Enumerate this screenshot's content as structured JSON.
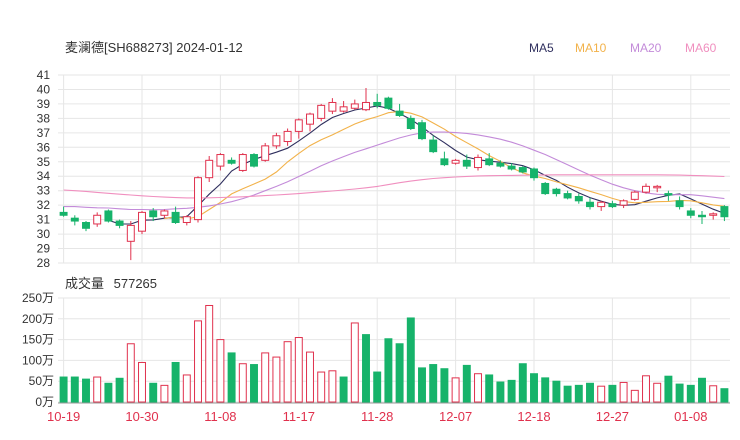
{
  "header": {
    "title": "麦澜德[SH688273] 2024-01-12",
    "legend": [
      {
        "label": "MA5",
        "color": "#2f2f5e"
      },
      {
        "label": "MA10",
        "color": "#f2b24a"
      },
      {
        "label": "MA20",
        "color": "#c38bd9"
      },
      {
        "label": "MA60",
        "color": "#f08fbf"
      }
    ]
  },
  "volume_header": {
    "label": "成交量",
    "value": "577265"
  },
  "colors": {
    "up": "#e0314d",
    "down": "#16b36a",
    "grid": "#e6e6e6",
    "axis": "#333333",
    "date_label": "#e0314d"
  },
  "chart_data": [
    {
      "type": "candlestick",
      "title": "麦澜德[SH688273] 2024-01-12",
      "ylim": [
        28,
        41
      ],
      "y_ticks": [
        "41",
        "40",
        "39",
        "38",
        "37",
        "36",
        "35",
        "34",
        "33",
        "32",
        "31",
        "30",
        "29",
        "28"
      ],
      "x_ticks": [
        {
          "label": "10-19",
          "index": 0
        },
        {
          "label": "10-30",
          "index": 7
        },
        {
          "label": "11-08",
          "index": 14
        },
        {
          "label": "11-17",
          "index": 21
        },
        {
          "label": "11-28",
          "index": 28
        },
        {
          "label": "12-07",
          "index": 35
        },
        {
          "label": "12-18",
          "index": 42
        },
        {
          "label": "12-27",
          "index": 49
        },
        {
          "label": "01-08",
          "index": 56
        }
      ],
      "grid": true,
      "ohlc": [
        [
          31.5,
          31.9,
          31.2,
          31.3
        ],
        [
          31.1,
          31.3,
          30.6,
          30.9
        ],
        [
          30.8,
          30.9,
          30.2,
          30.4
        ],
        [
          30.7,
          31.5,
          30.5,
          31.3
        ],
        [
          31.6,
          31.7,
          30.8,
          30.9
        ],
        [
          30.9,
          31.0,
          30.4,
          30.6
        ],
        [
          29.5,
          30.9,
          28.2,
          30.6
        ],
        [
          30.2,
          31.6,
          30.0,
          31.5
        ],
        [
          31.6,
          31.8,
          30.9,
          31.2
        ],
        [
          31.3,
          31.7,
          31.1,
          31.6
        ],
        [
          31.5,
          31.9,
          30.7,
          30.8
        ],
        [
          30.8,
          31.3,
          30.6,
          31.2
        ],
        [
          31.0,
          34.0,
          30.8,
          33.9
        ],
        [
          33.9,
          35.4,
          33.6,
          35.1
        ],
        [
          34.7,
          35.6,
          34.4,
          35.5
        ],
        [
          35.1,
          35.3,
          34.8,
          34.9
        ],
        [
          34.4,
          35.6,
          34.3,
          35.5
        ],
        [
          35.5,
          35.6,
          34.6,
          34.7
        ],
        [
          35.1,
          36.3,
          35.0,
          36.1
        ],
        [
          36.1,
          37.0,
          35.9,
          36.8
        ],
        [
          36.4,
          37.3,
          36.1,
          37.1
        ],
        [
          37.1,
          38.0,
          36.6,
          37.9
        ],
        [
          37.6,
          38.4,
          37.1,
          38.3
        ],
        [
          38.0,
          39.0,
          37.8,
          38.9
        ],
        [
          38.5,
          39.4,
          38.3,
          39.1
        ],
        [
          38.5,
          39.2,
          38.4,
          38.8
        ],
        [
          38.7,
          39.3,
          38.6,
          39.0
        ],
        [
          38.6,
          40.1,
          38.5,
          39.1
        ],
        [
          39.1,
          39.7,
          38.7,
          38.9
        ],
        [
          39.4,
          39.5,
          38.6,
          38.7
        ],
        [
          38.5,
          39.0,
          38.1,
          38.2
        ],
        [
          38.0,
          38.2,
          37.2,
          37.3
        ],
        [
          37.7,
          37.9,
          36.5,
          36.6
        ],
        [
          36.5,
          36.8,
          35.6,
          35.7
        ],
        [
          35.2,
          35.7,
          34.7,
          34.8
        ],
        [
          34.9,
          35.2,
          34.8,
          35.1
        ],
        [
          35.1,
          35.5,
          34.5,
          34.7
        ],
        [
          34.6,
          35.5,
          34.4,
          35.3
        ],
        [
          35.2,
          35.6,
          34.7,
          34.8
        ],
        [
          34.9,
          35.1,
          34.6,
          34.7
        ],
        [
          34.7,
          34.9,
          34.4,
          34.5
        ],
        [
          34.6,
          34.7,
          34.2,
          34.3
        ],
        [
          34.5,
          34.6,
          33.7,
          33.9
        ],
        [
          33.5,
          33.6,
          32.7,
          32.8
        ],
        [
          33.1,
          33.2,
          32.6,
          32.8
        ],
        [
          32.8,
          33.0,
          32.4,
          32.5
        ],
        [
          32.6,
          32.8,
          32.1,
          32.3
        ],
        [
          32.2,
          32.5,
          31.7,
          31.9
        ],
        [
          31.9,
          32.3,
          31.6,
          32.2
        ],
        [
          32.1,
          32.3,
          31.8,
          31.9
        ],
        [
          32.0,
          32.4,
          31.8,
          32.3
        ],
        [
          32.4,
          33.0,
          32.3,
          32.9
        ],
        [
          32.9,
          33.5,
          32.8,
          33.3
        ],
        [
          33.2,
          33.4,
          32.9,
          33.3
        ],
        [
          32.8,
          33.0,
          32.3,
          32.7
        ],
        [
          32.3,
          32.6,
          31.7,
          31.9
        ],
        [
          31.6,
          31.8,
          31.1,
          31.3
        ],
        [
          31.3,
          31.6,
          30.7,
          31.2
        ],
        [
          31.3,
          31.5,
          31.0,
          31.4
        ],
        [
          31.9,
          32.0,
          30.9,
          31.2
        ]
      ],
      "ma": {
        "MA5": [
          null,
          null,
          null,
          null,
          30.96,
          30.7,
          30.7,
          30.96,
          30.98,
          31.1,
          31.14,
          31.2,
          31.96,
          32.76,
          33.46,
          34.36,
          34.82,
          35.16,
          35.42,
          35.66,
          35.94,
          36.44,
          36.98,
          37.58,
          38.06,
          38.34,
          38.58,
          38.72,
          38.86,
          38.7,
          38.34,
          37.92,
          37.42,
          36.82,
          36.32,
          35.78,
          35.32,
          35.14,
          35.04,
          34.97,
          34.87,
          34.73,
          34.45,
          34.06,
          33.71,
          33.24,
          32.85,
          32.52,
          32.27,
          32.06,
          31.99,
          32.03,
          32.27,
          32.5,
          32.68,
          32.77,
          32.43,
          32.07,
          31.72,
          31.43
        ],
        "MA10": [
          null,
          null,
          null,
          null,
          null,
          null,
          null,
          null,
          null,
          31.07,
          31.2,
          31.04,
          31.21,
          31.7,
          32.19,
          32.78,
          33.13,
          33.46,
          33.8,
          34.29,
          34.99,
          35.58,
          36.12,
          36.52,
          36.86,
          37.24,
          37.61,
          37.9,
          38.12,
          38.39,
          38.48,
          38.36,
          38.1,
          37.68,
          37.25,
          36.75,
          36.32,
          35.89,
          35.43,
          35.03,
          34.59,
          34.24,
          34.01,
          33.84,
          33.61,
          33.41,
          33.2,
          32.96,
          32.73,
          32.47,
          32.25,
          32.16,
          32.2,
          32.24,
          32.26,
          32.33,
          32.3,
          32.16,
          32.02,
          31.92
        ],
        "MA20": [
          31.9,
          31.9,
          31.85,
          31.82,
          31.8,
          31.75,
          31.7,
          31.7,
          31.68,
          31.7,
          31.75,
          31.78,
          31.85,
          31.95,
          32.08,
          32.24,
          32.45,
          32.7,
          33.0,
          33.3,
          33.62,
          33.98,
          34.35,
          34.72,
          35.05,
          35.36,
          35.65,
          35.9,
          36.15,
          36.4,
          36.65,
          36.85,
          37.0,
          37.05,
          37.05,
          37.02,
          36.96,
          36.86,
          36.72,
          36.56,
          36.35,
          36.1,
          35.8,
          35.5,
          35.15,
          34.8,
          34.43,
          34.08,
          33.75,
          33.45,
          33.2,
          33.0,
          32.85,
          32.75,
          32.72,
          32.72,
          32.72,
          32.65,
          32.55,
          32.45
        ],
        "MA60": [
          33.05,
          33.0,
          32.95,
          32.88,
          32.82,
          32.76,
          32.7,
          32.65,
          32.6,
          32.56,
          32.52,
          32.5,
          32.5,
          32.51,
          32.53,
          32.55,
          32.58,
          32.62,
          32.66,
          32.7,
          32.75,
          32.8,
          32.86,
          32.92,
          32.98,
          33.05,
          33.12,
          33.2,
          33.3,
          33.42,
          33.55,
          33.66,
          33.76,
          33.84,
          33.9,
          33.95,
          33.99,
          34.02,
          34.04,
          34.05,
          34.06,
          34.07,
          34.08,
          34.09,
          34.1,
          34.1,
          34.1,
          34.1,
          34.1,
          34.1,
          34.1,
          34.1,
          34.1,
          34.1,
          34.09,
          34.08,
          34.06,
          34.04,
          34.01,
          33.98
        ]
      }
    },
    {
      "type": "bar",
      "title": "成交量 577265",
      "ylim": [
        0,
        250
      ],
      "y_ticks": [
        "250万",
        "200万",
        "150万",
        "100万",
        "50万",
        "0万"
      ],
      "values": [
        60,
        60,
        55,
        60,
        45,
        57,
        140,
        95,
        45,
        40,
        95,
        65,
        195,
        232,
        150,
        118,
        92,
        90,
        118,
        108,
        145,
        155,
        120,
        72,
        75,
        60,
        190,
        162,
        72,
        152,
        140,
        202,
        82,
        90,
        80,
        58,
        88,
        68,
        65,
        48,
        52,
        92,
        68,
        58,
        50,
        38,
        40,
        45,
        38,
        40,
        47,
        28,
        63,
        45,
        62,
        43,
        40,
        57,
        39,
        32
      ],
      "up_flags": [
        0,
        0,
        0,
        1,
        0,
        0,
        1,
        1,
        0,
        1,
        0,
        1,
        1,
        1,
        1,
        0,
        1,
        0,
        1,
        1,
        1,
        1,
        1,
        1,
        1,
        0,
        1,
        0,
        0,
        0,
        0,
        0,
        0,
        0,
        0,
        1,
        0,
        1,
        0,
        0,
        0,
        0,
        0,
        0,
        0,
        0,
        0,
        0,
        1,
        0,
        1,
        1,
        1,
        1,
        0,
        0,
        0,
        0,
        1,
        0
      ]
    }
  ]
}
